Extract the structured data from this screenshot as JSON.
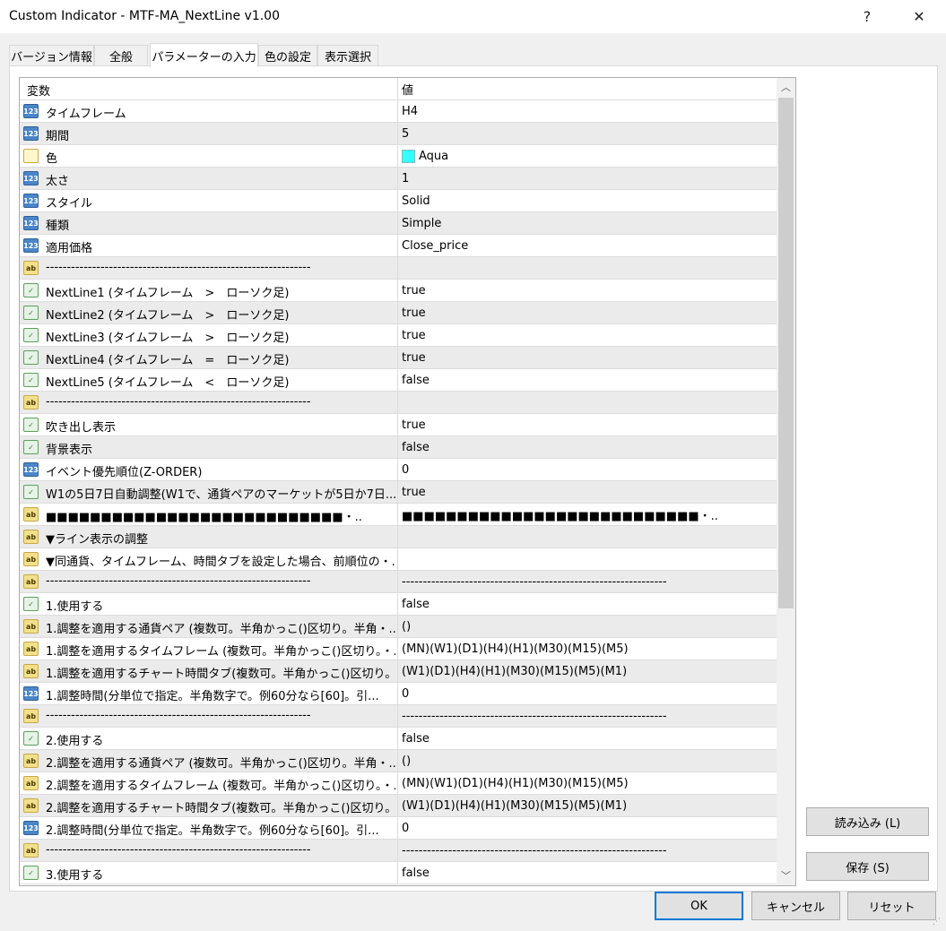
{
  "window": {
    "title": "Custom Indicator - MTF-MA_NextLine v1.00",
    "help_label": "?",
    "close_label": "✕"
  },
  "tabs": [
    {
      "label": "バージョン情報"
    },
    {
      "label": "全般"
    },
    {
      "label": "パラメーターの入力",
      "active": true
    },
    {
      "label": "色の設定"
    },
    {
      "label": "表示選択"
    }
  ],
  "table": {
    "header": {
      "name": "変数",
      "value": "値"
    },
    "rows": [
      {
        "icon": "num",
        "name": "タイムフレーム",
        "value": "H4"
      },
      {
        "icon": "num",
        "name": "期間",
        "value": "5"
      },
      {
        "icon": "color",
        "name": "色",
        "value": "Aqua",
        "swatch": "#33ffff"
      },
      {
        "icon": "num",
        "name": "太さ",
        "value": "1"
      },
      {
        "icon": "num",
        "name": "スタイル",
        "value": "Solid"
      },
      {
        "icon": "num",
        "name": "種類",
        "value": "Simple"
      },
      {
        "icon": "num",
        "name": "適用価格",
        "value": "Close_price"
      },
      {
        "icon": "ab",
        "name": "---------------------------------------------------------------",
        "value": ""
      },
      {
        "icon": "bool",
        "name": "NextLine1 (タイムフレーム　>　ローソク足)",
        "value": "true"
      },
      {
        "icon": "bool",
        "name": "NextLine2 (タイムフレーム　>　ローソク足)",
        "value": "true"
      },
      {
        "icon": "bool",
        "name": "NextLine3 (タイムフレーム　>　ローソク足)",
        "value": "true"
      },
      {
        "icon": "bool",
        "name": "NextLine4 (タイムフレーム　=　ローソク足)",
        "value": "true"
      },
      {
        "icon": "bool",
        "name": "NextLine5 (タイムフレーム　<　ローソク足)",
        "value": "false"
      },
      {
        "icon": "ab",
        "name": "---------------------------------------------------------------",
        "value": ""
      },
      {
        "icon": "bool",
        "name": "吹き出し表示",
        "value": "true"
      },
      {
        "icon": "bool",
        "name": "背景表示",
        "value": "false"
      },
      {
        "icon": "num",
        "name": "イベント優先順位(Z-ORDER)",
        "value": "0"
      },
      {
        "icon": "bool",
        "name": "W1の5日7日自動調整(W1で、通貨ペアのマーケットが5日か7日...",
        "value": "true"
      },
      {
        "icon": "ab",
        "name": "■■■■■■■■■■■■■■■■■■■■■■■■■■■・..",
        "value": "■■■■■■■■■■■■■■■■■■■■■■■■■■■・.."
      },
      {
        "icon": "ab",
        "name": "▼ライン表示の調整",
        "value": ""
      },
      {
        "icon": "ab",
        "name": "▼同通貨、タイムフレーム、時間タブを設定した場合、前順位の・..",
        "value": ""
      },
      {
        "icon": "ab",
        "name": "---------------------------------------------------------------",
        "value": "---------------------------------------------------------------"
      },
      {
        "icon": "bool",
        "name": "1.使用する",
        "value": "false"
      },
      {
        "icon": "ab",
        "name": "1.調整を適用する通貨ペア (複数可。半角かっこ()区切り。半角・..",
        "value": "()"
      },
      {
        "icon": "ab",
        "name": "1.調整を適用するタイムフレーム (複数可。半角かっこ()区切り。・..",
        "value": "(MN)(W1)(D1)(H4)(H1)(M30)(M15)(M5)"
      },
      {
        "icon": "ab",
        "name": "1.調整を適用するチャート時間タブ(複数可。半角かっこ()区切り。...",
        "value": "(W1)(D1)(H4)(H1)(M30)(M15)(M5)(M1)"
      },
      {
        "icon": "num",
        "name": "1.調整時間(分単位で指定。半角数字で。例60分なら[60]。引...",
        "value": "0"
      },
      {
        "icon": "ab",
        "name": "---------------------------------------------------------------",
        "value": "---------------------------------------------------------------"
      },
      {
        "icon": "bool",
        "name": "2.使用する",
        "value": "false"
      },
      {
        "icon": "ab",
        "name": "2.調整を適用する通貨ペア (複数可。半角かっこ()区切り。半角・..",
        "value": "()"
      },
      {
        "icon": "ab",
        "name": "2.調整を適用するタイムフレーム (複数可。半角かっこ()区切り。・..",
        "value": "(MN)(W1)(D1)(H4)(H1)(M30)(M15)(M5)"
      },
      {
        "icon": "ab",
        "name": "2.調整を適用するチャート時間タブ(複数可。半角かっこ()区切り。...",
        "value": "(W1)(D1)(H4)(H1)(M30)(M15)(M5)(M1)"
      },
      {
        "icon": "num",
        "name": "2.調整時間(分単位で指定。半角数字で。例60分なら[60]。引...",
        "value": "0"
      },
      {
        "icon": "ab",
        "name": "---------------------------------------------------------------",
        "value": "---------------------------------------------------------------"
      },
      {
        "icon": "bool",
        "name": "3.使用する",
        "value": "false"
      }
    ]
  },
  "icon_labels": {
    "num": "123",
    "ab": "ab",
    "bool": "✓",
    "color": ""
  },
  "buttons": {
    "load": "読み込み (L)",
    "save": "保存 (S)",
    "ok": "OK",
    "cancel": "キャンセル",
    "reset": "リセット"
  },
  "scroll": {
    "up": "︿",
    "down": "﹀"
  }
}
